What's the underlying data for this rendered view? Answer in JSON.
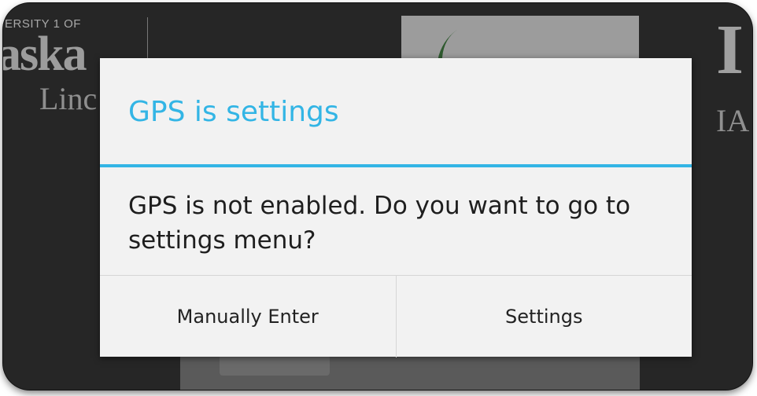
{
  "background": {
    "logo_left": {
      "top_text": "ERSITY 1 OF",
      "main_text": "aska",
      "sub_text": "Linc"
    },
    "logo_right": {
      "main_text": "I",
      "sub_text": "IA"
    }
  },
  "dialog": {
    "title": "GPS is settings",
    "message": "GPS is not enabled. Do you want to go to settings menu?",
    "buttons": {
      "negative_label": "Manually Enter",
      "positive_label": "Settings"
    }
  },
  "colors": {
    "accent": "#33b5e5",
    "dialog_background": "#f2f2f2",
    "text": "#1e1e1e"
  }
}
